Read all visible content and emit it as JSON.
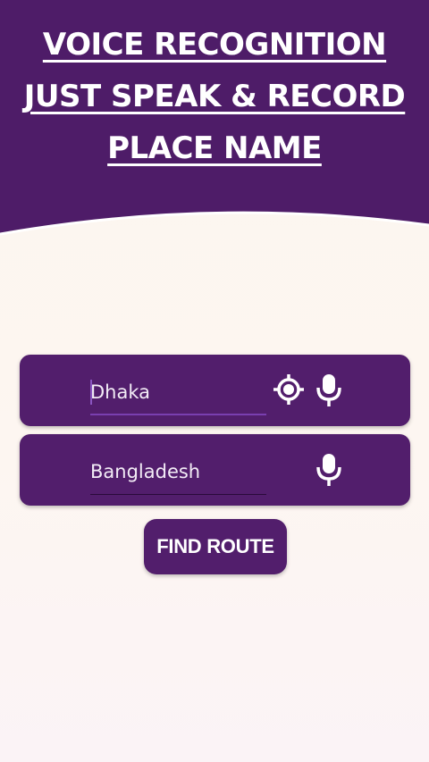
{
  "header": {
    "line1": "VOICE RECOGNITION",
    "line2": "JUST SPEAK &  RECORD",
    "line3": "PLACE NAME",
    "background": "#4e1c68"
  },
  "from_field": {
    "value": "Dhaka",
    "icons": [
      "target-icon",
      "mic-icon"
    ]
  },
  "to_field": {
    "value": "Bangladesh",
    "icons": [
      "mic-icon"
    ]
  },
  "actions": {
    "find_route_label": "FIND ROUTE"
  },
  "colors": {
    "primary": "#521e6c",
    "background": "#fcf5ee",
    "text_on_primary": "#ffffff"
  }
}
